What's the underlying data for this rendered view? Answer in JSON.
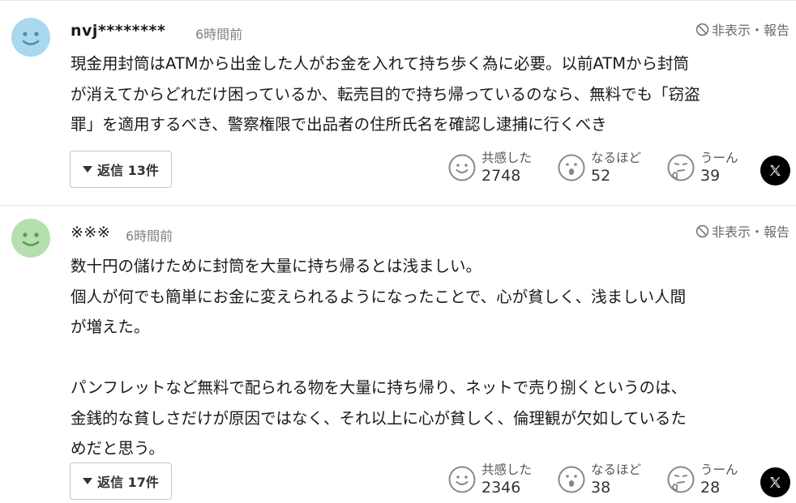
{
  "comments": [
    {
      "username": "nvj********",
      "time": "6時間前",
      "report": "非表示・報告",
      "avatar_color": "#a9d8ef",
      "body": "現金用封筒はATMから出金した人がお金を入れて持ち歩く為に必要。以前ATMから封筒\nが消えてからどれだけ困っているか、転売目的で持ち帰っているのなら、無料でも「窃盗\n罪」を適用するべき、警察権限で出品者の住所氏名を確認し逮捕に行くべき",
      "reply_label": "返信 13件",
      "reactions": [
        {
          "icon": "smile-icon",
          "label": "共感した",
          "count": "2748"
        },
        {
          "icon": "surprised-icon",
          "label": "なるほど",
          "count": "52"
        },
        {
          "icon": "thinking-icon",
          "label": "うーん",
          "count": "39"
        }
      ],
      "share_icon": "x-logo-icon"
    },
    {
      "username": "※※※",
      "time": "6時間前",
      "report": "非表示・報告",
      "avatar_color": "#b5dfae",
      "body": "数十円の儲けために封筒を大量に持ち帰るとは浅ましい。\n個人が何でも簡単にお金に変えられるようになったことで、心が貧しく、浅ましい人間\nが増えた。\n\nパンフレットなど無料で配られる物を大量に持ち帰り、ネットで売り捌くというのは、\n金銭的な貧しさだけが原因ではなく、それ以上に心が貧しく、倫理観が欠如しているた\nめだと思う。",
      "reply_label": "返信 17件",
      "reactions": [
        {
          "icon": "smile-icon",
          "label": "共感した",
          "count": "2346"
        },
        {
          "icon": "surprised-icon",
          "label": "なるほど",
          "count": "38"
        },
        {
          "icon": "thinking-icon",
          "label": "うーん",
          "count": "28"
        }
      ],
      "share_icon": "x-logo-icon"
    }
  ]
}
